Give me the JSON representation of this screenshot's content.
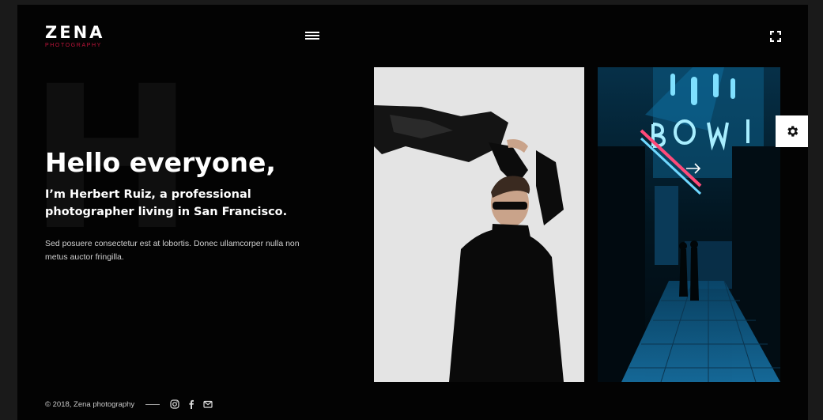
{
  "brand": {
    "name": "ZENA",
    "tagline": "PHOTOGRAPHY"
  },
  "hero": {
    "background_letter": "H",
    "headline": "Hello everyone,",
    "subheadline": "I’m Herbert Ruiz, a professional photographer living in San Francisco.",
    "body": "Sed posuere consectetur est at lobortis. Donec ullamcorper nulla non metus auctor fringilla."
  },
  "footer": {
    "copyright": "© 2018, Zena photography"
  },
  "icons": {
    "menu": "hamburger-menu-icon",
    "fullscreen": "fullscreen-icon",
    "settings": "gear-icon",
    "next": "arrow-right-icon",
    "social": [
      "instagram-icon",
      "facebook-icon",
      "mail-icon"
    ]
  },
  "colors": {
    "background": "#030303",
    "accent": "#c0153b",
    "text": "#ffffff"
  }
}
